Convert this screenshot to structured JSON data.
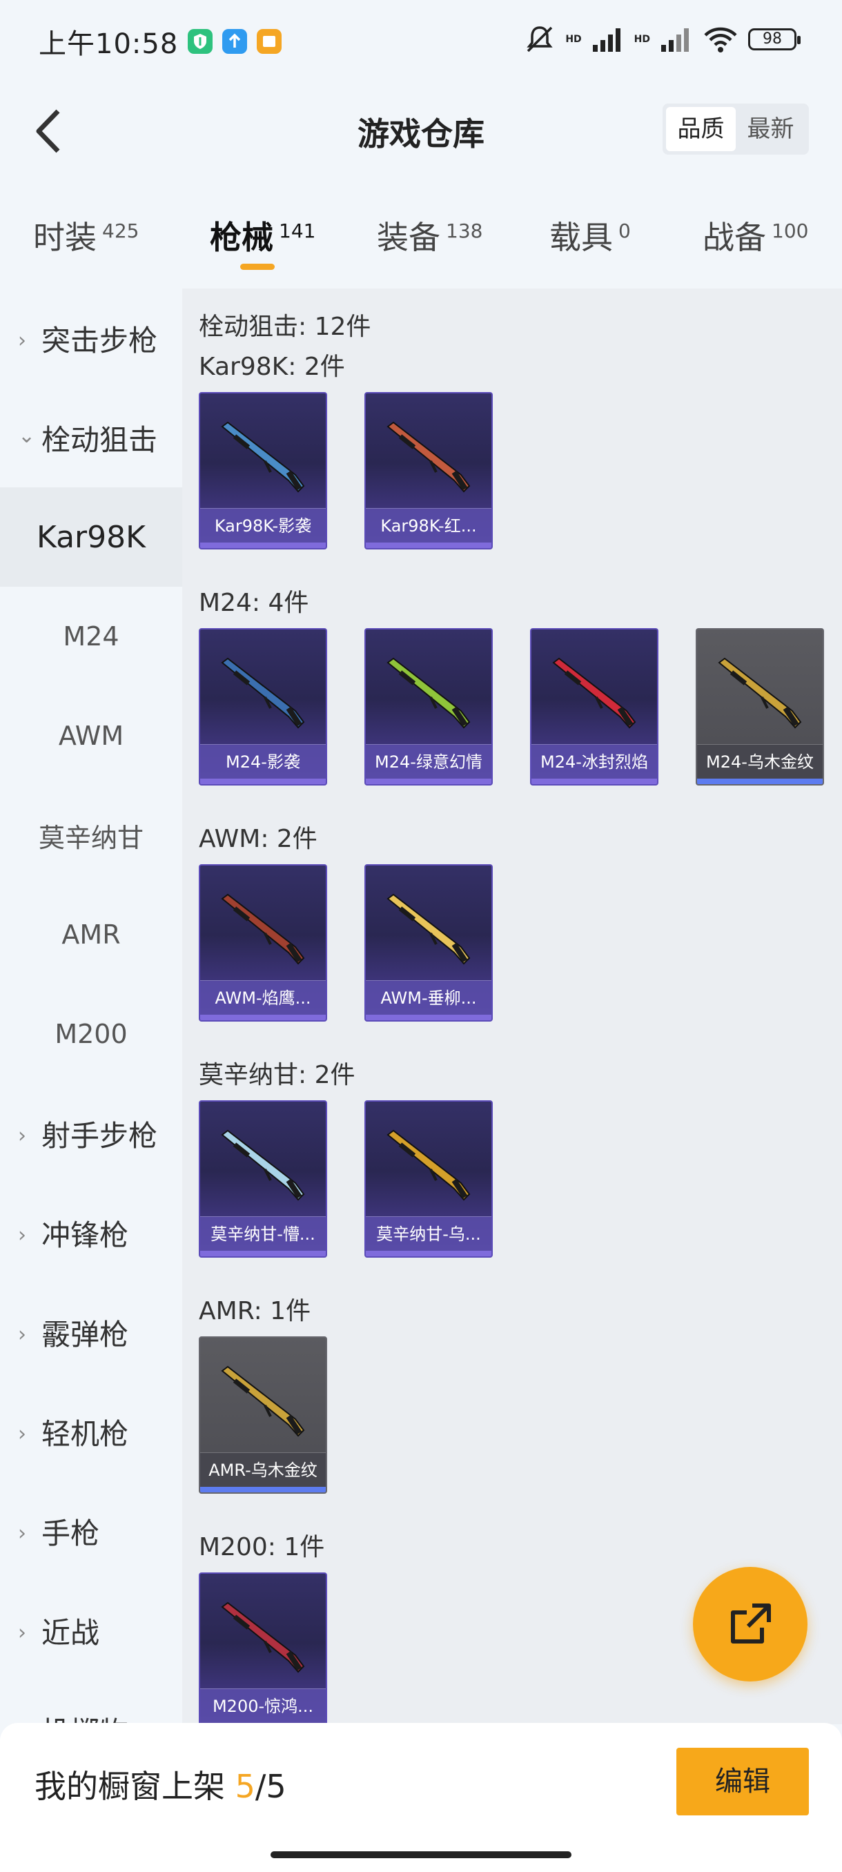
{
  "status_bar": {
    "time": "上午10:58",
    "battery": "98",
    "hd_label": "HD"
  },
  "header": {
    "title": "游戏仓库",
    "sort_options": [
      "品质",
      "最新"
    ],
    "active_sort": "品质"
  },
  "tabs": [
    {
      "label": "时装",
      "count": "425"
    },
    {
      "label": "枪械",
      "count": "141"
    },
    {
      "label": "装备",
      "count": "138"
    },
    {
      "label": "载具",
      "count": "0"
    },
    {
      "label": "战备",
      "count": "100"
    }
  ],
  "active_tab": "枪械",
  "sidebar": {
    "categories": [
      {
        "label": "突击步枪"
      },
      {
        "label": "栓动狙击"
      },
      {
        "label": "射手步枪"
      },
      {
        "label": "冲锋枪"
      },
      {
        "label": "霰弹枪"
      },
      {
        "label": "轻机枪"
      },
      {
        "label": "手枪"
      },
      {
        "label": "近战"
      },
      {
        "label": "投掷物"
      }
    ],
    "subitems": [
      "Kar98K",
      "M24",
      "AWM",
      "莫辛纳甘",
      "AMR",
      "M200"
    ],
    "active_subitem": "Kar98K"
  },
  "main": {
    "section_heading": "栓动狙击: 12件",
    "groups": [
      {
        "title": "Kar98K: 2件",
        "items": [
          {
            "name": "Kar98K-影袭",
            "rarity": "purple",
            "color": "#4a8cc7"
          },
          {
            "name": "Kar98K-红...",
            "rarity": "purple",
            "color": "#c25a3e"
          }
        ]
      },
      {
        "title": "M24: 4件",
        "items": [
          {
            "name": "M24-影袭",
            "rarity": "purple",
            "color": "#3b6fb0"
          },
          {
            "name": "M24-绿意幻情",
            "rarity": "purple",
            "color": "#8fc43a"
          },
          {
            "name": "M24-冰封烈焰",
            "rarity": "purple",
            "color": "#d02a3a"
          },
          {
            "name": "M24-乌木金纹",
            "rarity": "gray",
            "color": "#c9a23a"
          }
        ]
      },
      {
        "title": "AWM: 2件",
        "items": [
          {
            "name": "AWM-焰鹰...",
            "rarity": "purple",
            "color": "#a04030"
          },
          {
            "name": "AWM-垂柳...",
            "rarity": "purple",
            "color": "#e8c45a"
          }
        ]
      },
      {
        "title": "莫辛纳甘: 2件",
        "items": [
          {
            "name": "莫辛纳甘-懵...",
            "rarity": "purple",
            "color": "#a9d4e8"
          },
          {
            "name": "莫辛纳甘-乌...",
            "rarity": "purple",
            "color": "#d4a02a"
          }
        ]
      },
      {
        "title": "AMR: 1件",
        "items": [
          {
            "name": "AMR-乌木金纹",
            "rarity": "gray",
            "color": "#c9a23a"
          }
        ]
      },
      {
        "title": "M200: 1件",
        "items": [
          {
            "name": "M200-惊鸿...",
            "rarity": "purple",
            "color": "#b03040"
          }
        ]
      }
    ]
  },
  "bottom_bar": {
    "showcase_prefix": "我的橱窗上架",
    "showcase_current": "5",
    "showcase_total": "/5",
    "edit_label": "编辑"
  }
}
